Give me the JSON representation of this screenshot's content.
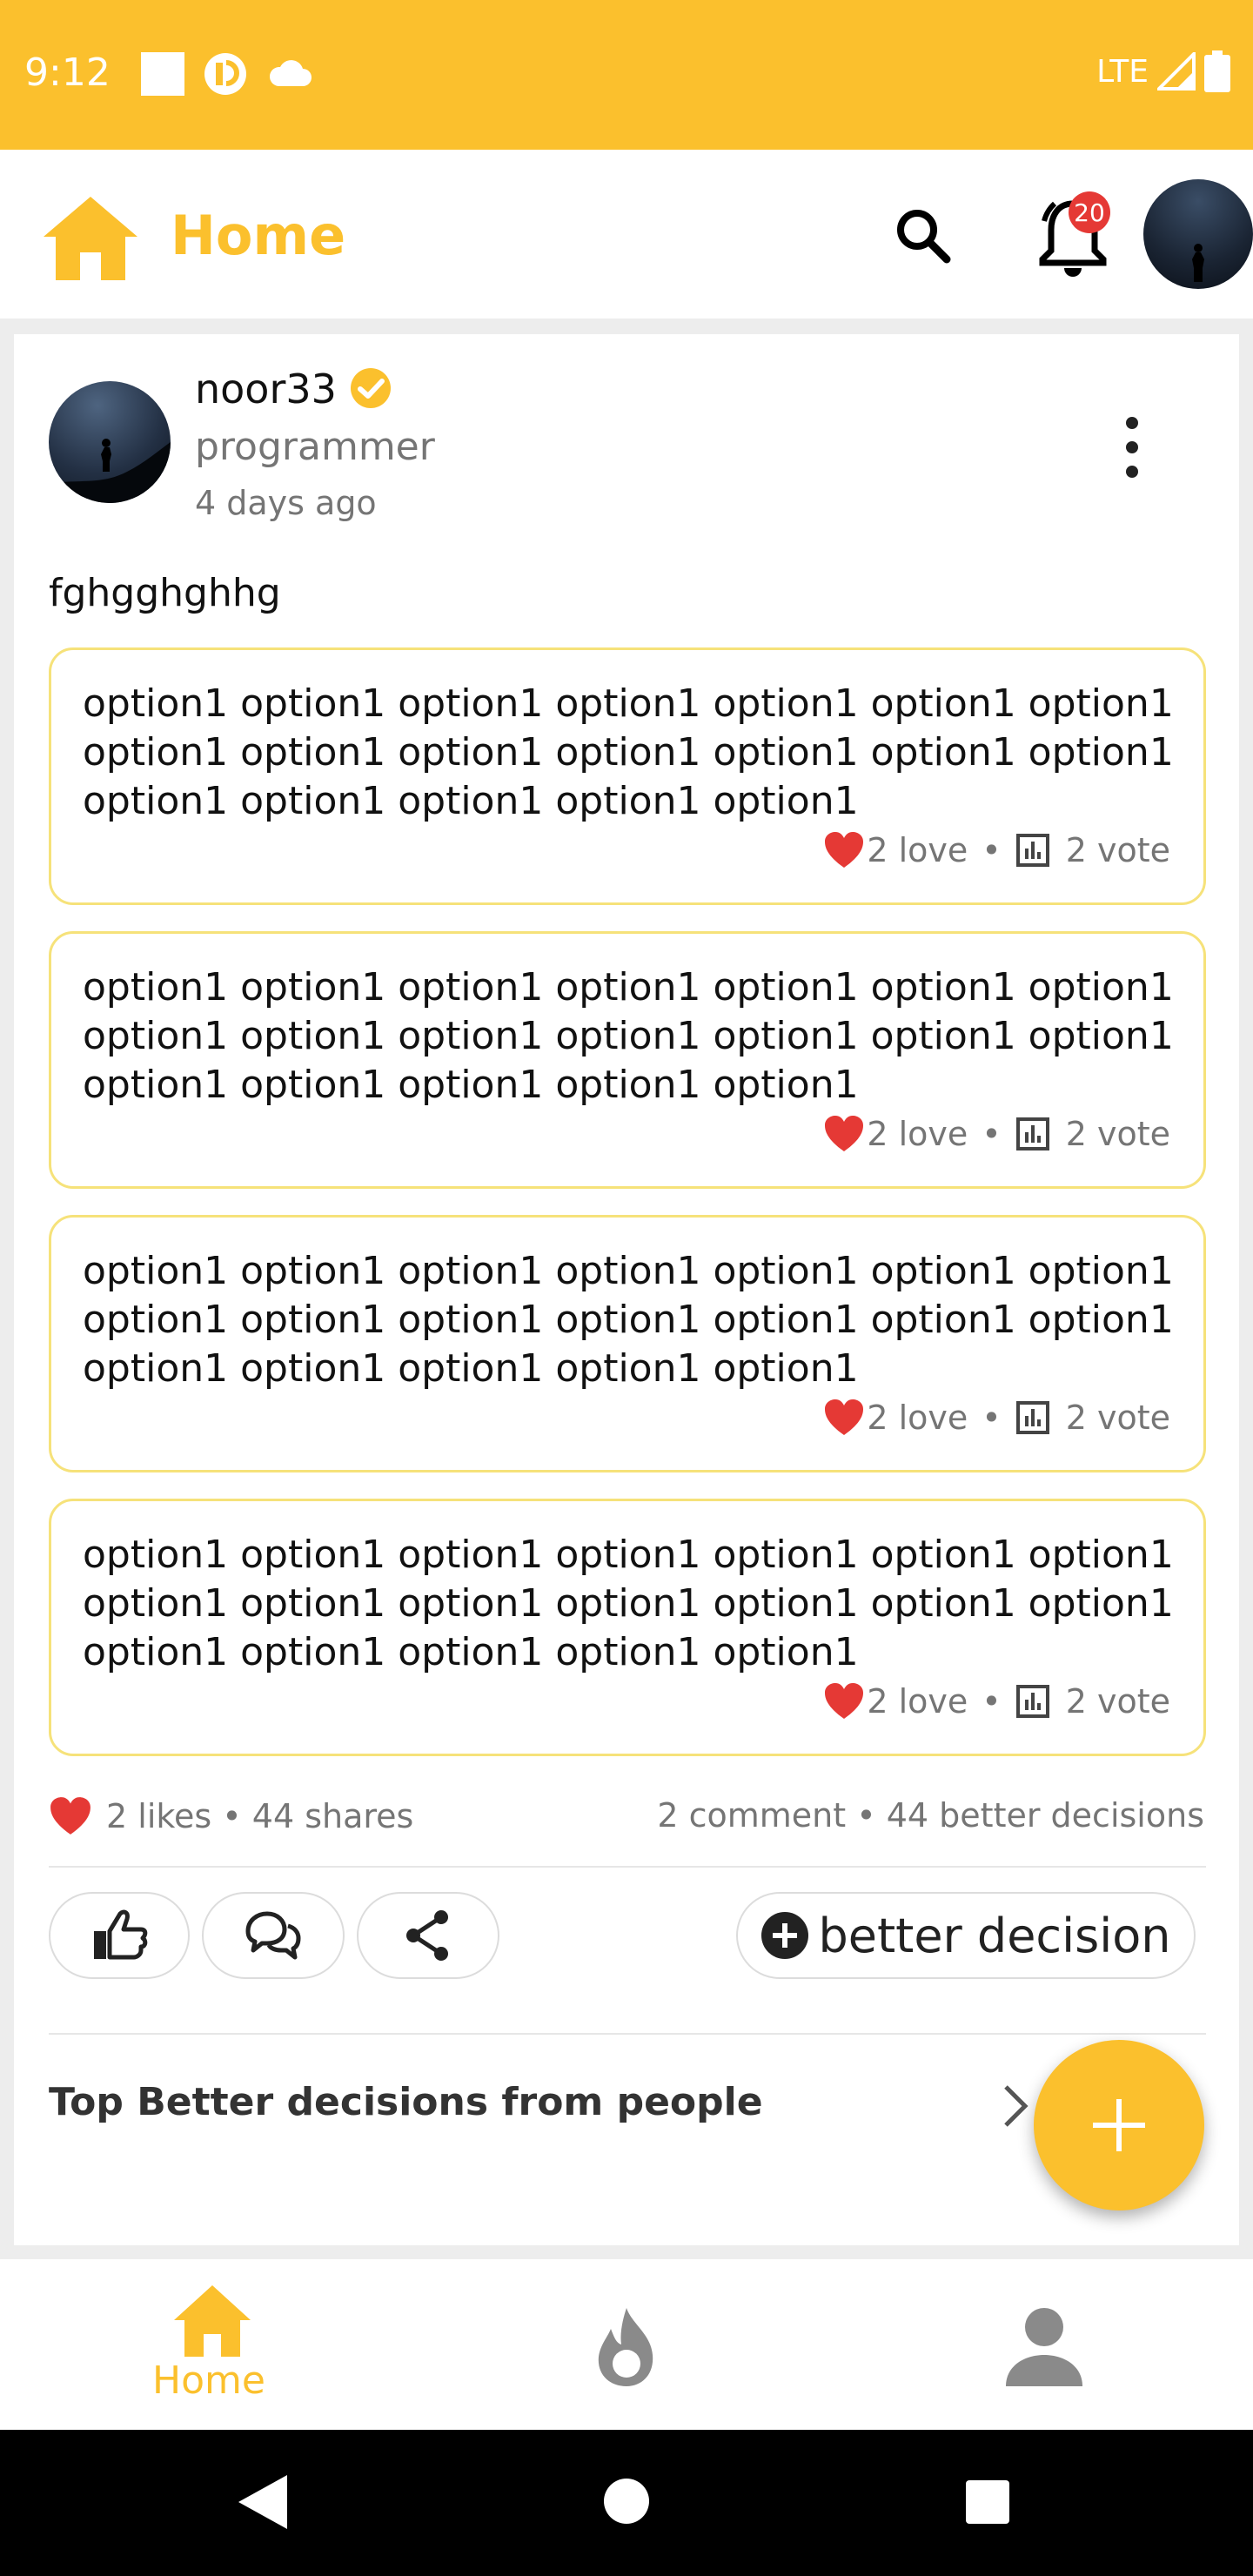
{
  "status_bar": {
    "time": "9:12",
    "network": "LTE"
  },
  "app_bar": {
    "title": "Home",
    "notification_count": "20"
  },
  "post": {
    "author": "noor33",
    "role": "programmer",
    "time": "4 days ago",
    "text": "fghgghghhg",
    "options": [
      {
        "text": "option1 option1 option1 option1 option1 option1 option1 option1 option1 option1 option1 option1 option1 option1 option1 option1 option1 option1 option1",
        "loves": "2 love",
        "votes": "2 vote"
      },
      {
        "text": "option1 option1 option1 option1 option1 option1 option1 option1 option1 option1 option1 option1 option1 option1 option1 option1 option1 option1 option1",
        "loves": "2 love",
        "votes": "2 vote"
      },
      {
        "text": "option1 option1 option1 option1 option1 option1 option1 option1 option1 option1 option1 option1 option1 option1 option1 option1 option1 option1 option1",
        "loves": "2 love",
        "votes": "2 vote"
      },
      {
        "text": "option1 option1 option1 option1 option1 option1 option1 option1 option1 option1 option1 option1 option1 option1 option1 option1 option1 option1 option1",
        "loves": "2 love",
        "votes": "2 vote"
      }
    ],
    "likes_shares": "2 likes • 44 shares",
    "comments_decisions": "2 comment • 44 better decisions",
    "better_decision_label": "better decision",
    "top_better_label": "Top Better decisions from people"
  },
  "bottom_nav": {
    "home_label": "Home"
  },
  "colors": {
    "primary": "#fbc02d",
    "heart": "#e53935",
    "badge": "#e53935"
  }
}
